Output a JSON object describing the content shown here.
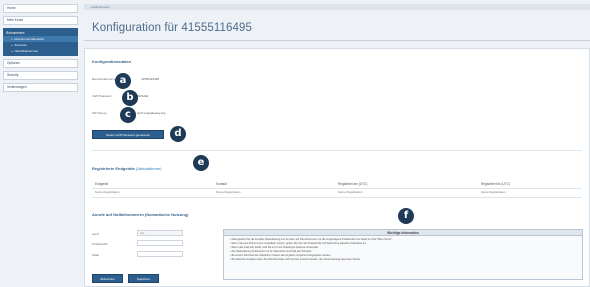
{
  "sidebar": {
    "items_top": [
      "Home",
      "Mein Konto"
    ],
    "group": {
      "title": "Rufnummern",
      "items": [
        "Rufnummernübersicht",
        "Accounts",
        "Notrufzielnummer"
      ],
      "active_index": 0
    },
    "items_bottom": [
      "Optionen",
      "Security",
      "Verbindungen"
    ]
  },
  "breadcrumb": "» Rufnummern",
  "page_title": "Konfiguration für 41555116495",
  "config": {
    "title": "Konfigurationsdaten",
    "rows": [
      {
        "label": "Benutzerkennung",
        "value": "41555116495"
      },
      {
        "label": "VoIP Passwort",
        "value": "GKESddd"
      },
      {
        "label": "SIP-Server",
        "value": "sipX.voipgateway.org"
      }
    ],
    "new_password_button": "Neues VoIP Passwort generieren"
  },
  "devices": {
    "title": "Registrierte Endgeräte",
    "refresh_link": "(Aktualisieren)",
    "columns": [
      "Endgerät",
      "Kontakt",
      "Registriert am (UTC)",
      "Registriert bis (UTC)"
    ],
    "row": [
      "Keine Registration",
      "Keine Registration",
      "Keine Registration",
      "Keine Registration"
    ]
  },
  "emergency": {
    "title": "Anrufe auf Notfallnummern (Nomadische Nutzung)",
    "fields": [
      {
        "label": "Land",
        "value": "CH"
      },
      {
        "label": "Postleitzahl",
        "value": ""
      },
      {
        "label": "Stadt",
        "value": ""
      }
    ],
    "delete_button": "Abbrechen",
    "save_button": "Speichern"
  },
  "info": {
    "title": "Wichtige Information",
    "lines": [
      "Massgebend für die korrekte Weiterleitung von Anrufen auf Notrufnummern ist die eingetragene Postleitzahl und Stadt im Feld \"Mein Konto\".",
      "Wenn Sie eine Rufnummer nomadisch nutzen, geben Sie hier die Postleitzahl und Stadt Ihres aktuellen Standorts an.",
      "Wenn das Feld leer bleibt, wird die im Konto hinterlegte Adresse verwendet.",
      "Die Weiterleitung funktioniert nur für Standorte innerhalb der Schweiz.",
      "Bei einem Wechsel des Standorts müssen die Angaben umgehend angepasst werden.",
      "Bei falschen Angaben kann die Notrufzentrale nicht korrekt erreicht werden; die Verantwortung liegt beim Nutzer."
    ]
  },
  "markers": [
    "a",
    "b",
    "c",
    "d",
    "e",
    "f"
  ]
}
